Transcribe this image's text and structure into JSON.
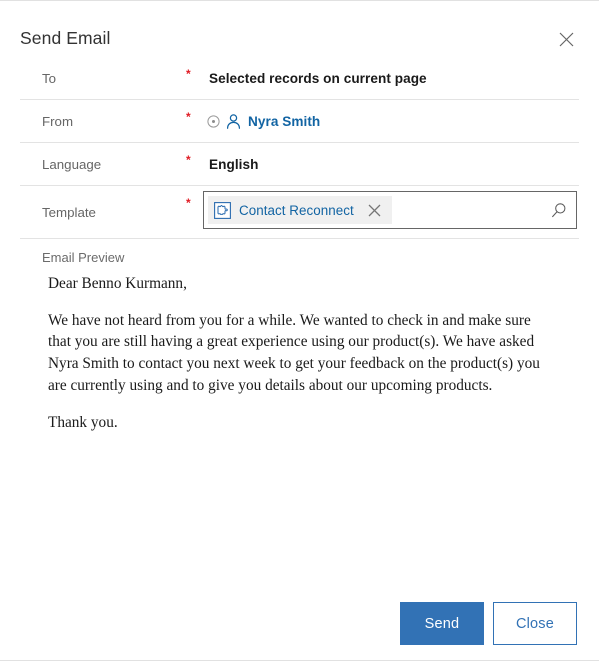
{
  "dialog": {
    "title": "Send Email",
    "close_icon": "close-icon"
  },
  "fields": [
    {
      "label": "To",
      "required_marker": "*",
      "value": "Selected records on current page"
    },
    {
      "label": "From",
      "required_marker": "*",
      "value": "Nyra Smith",
      "presence_icon": "presence-indicator-icon",
      "person_icon": "contact-person-icon"
    },
    {
      "label": "Language",
      "required_marker": "*",
      "value": "English"
    },
    {
      "label": "Template",
      "required_marker": "*",
      "chip_label": "Contact Reconnect",
      "chip_icon": "template-icon",
      "chip_remove_icon": "remove-chip-icon",
      "search_icon": "search-icon"
    }
  ],
  "preview": {
    "caption": "Email Preview",
    "greeting": "Dear Benno Kurmann,",
    "body": "We have not heard from you for a while. We wanted to check in and make sure that you are still having a great experience using our product(s). We have asked Nyra Smith to contact you next week to get your feedback on the product(s) you are currently using and to give you details about our upcoming products.",
    "closing": "Thank you."
  },
  "footer": {
    "send_label": "Send",
    "close_label": "Close"
  },
  "colors": {
    "accent_blue": "#3272b5",
    "link_blue": "#1264a3",
    "required_red": "#e01b24",
    "label_gray": "#666666",
    "rule_gray": "#e3e3e3"
  }
}
